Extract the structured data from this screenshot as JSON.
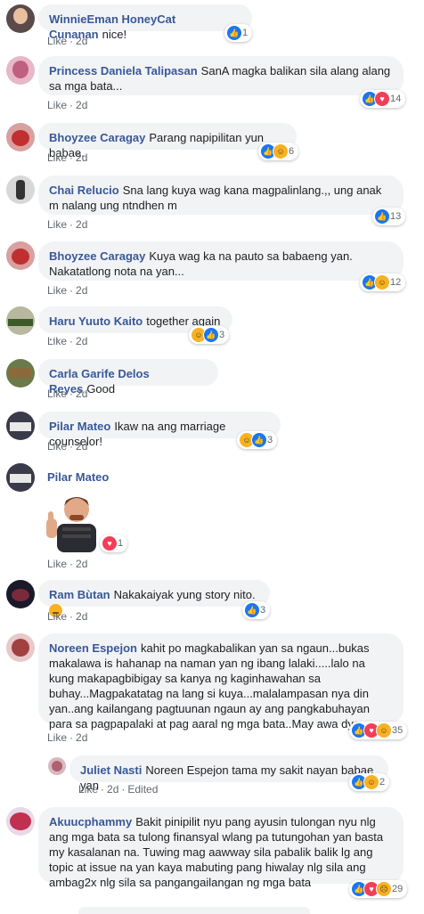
{
  "comments": [
    {
      "name": "WinnieEman HoneyCat Cunanan",
      "text": "nice!",
      "like": "Like",
      "time": "2d",
      "reactions": "1",
      "icons": [
        "like"
      ]
    },
    {
      "name": "Princess Daniela Talipasan",
      "text": "SanA magka balikan sila alang alang sa mga bata...",
      "like": "Like",
      "time": "2d",
      "reactions": "14",
      "icons": [
        "like",
        "love"
      ]
    },
    {
      "name": "Bhoyzee Caragay",
      "text": "Parang napipilitan yun babae.",
      "like": "Like",
      "time": "2d",
      "reactions": "6",
      "icons": [
        "like",
        "haha"
      ]
    },
    {
      "name": "Chai Relucio",
      "text": "Sna lang kuya wag kana magpalinlang.,, ung anak m nalang ung ntndhen m",
      "like": "Like",
      "time": "2d",
      "reactions": "13",
      "icons": [
        "like"
      ]
    },
    {
      "name": "Bhoyzee Caragay",
      "text": "Kuya wag ka na pauto sa babaeng yan. Nakatatlong nota na yan...",
      "like": "Like",
      "time": "2d",
      "reactions": "12",
      "icons": [
        "like",
        "haha"
      ]
    },
    {
      "name": "Haru Yuuto Kaito",
      "text": "together again ...",
      "like": "Like",
      "time": "2d",
      "reactions": "3",
      "icons": [
        "haha",
        "like"
      ]
    },
    {
      "name": "Carla Garife Delos Reyes",
      "text": "Good",
      "like": "Like",
      "time": "2d"
    },
    {
      "name": "Pilar Mateo",
      "text": "Ikaw na ang marriage counselor!",
      "like": "Like",
      "time": "2d",
      "reactions": "3",
      "icons": [
        "haha",
        "like"
      ]
    },
    {
      "name": "Pilar Mateo",
      "text": "",
      "like": "Like",
      "time": "2d",
      "reactions": "1",
      "icons": [
        "love"
      ]
    },
    {
      "name": "Ram Bùtan",
      "text": "Nakakaiyak yung story nito.",
      "like": "Like",
      "time": "2d",
      "reactions": "3",
      "icons": [
        "like"
      ]
    },
    {
      "name": "Noreen Espejon",
      "text": "kahit po magkabalikan yan sa ngaun...bukas makalawa is hahanap na naman yan ng ibang lalaki.....lalo na kung makapagbibigay sa kanya ng kaginhawahan sa buhay...Magpakatatag na lang si kuya...malalampasan nya din yan..ang kailangang pagtuunan ngaun ay ang pangkabuhayan para sa pagpapalaki at pag aaral ng mga bata..May awa dyos...",
      "like": "Like",
      "time": "2d",
      "reactions": "35",
      "icons": [
        "like",
        "love",
        "haha"
      ]
    },
    {
      "name": "Juliet Nasti",
      "text": "Noreen Espejon tama my sakit nayan babae yan",
      "like": "Like",
      "time": "2d",
      "edited": "Edited",
      "reactions": "2",
      "icons": [
        "like",
        "haha"
      ]
    },
    {
      "name": "Akuucphammy",
      "text": "Bakit pinipilit nyu pang ayusin tulongan nyu nlg ang mga bata sa tulong finansyal wlang pa tutungohan yan basta my kasalanan na. Tuwing mag aawway sila pabalik balik lg ang topic at issue na yan kaya mabuting pang hiwalay nlg sila ang ambag2x nlg sila sa pangangailangan ng mga bata",
      "like": "Like",
      "time": "2d",
      "reactions": "29",
      "icons": [
        "like",
        "love",
        "sad"
      ]
    }
  ],
  "colors": {
    "name": "#385898",
    "bubble": "#f2f3f5",
    "meta": "#606770",
    "like_blue": "#1877f2",
    "love_red": "#f33e58",
    "haha_yellow": "#f7b125"
  }
}
